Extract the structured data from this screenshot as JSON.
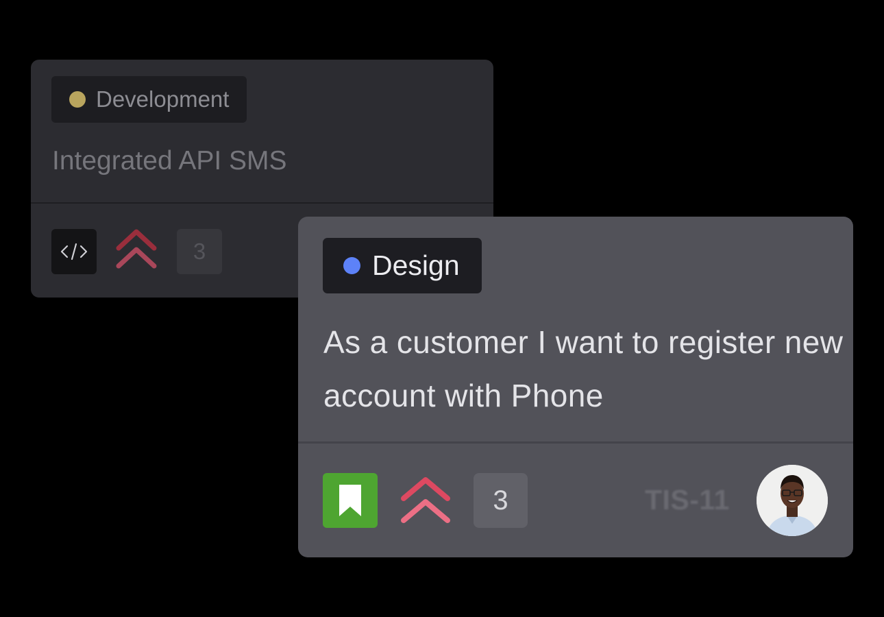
{
  "back_card": {
    "tag": {
      "label": "Development",
      "dot_color": "#b9a55e"
    },
    "title": "Integrated API SMS",
    "type_icon": "code-icon",
    "priority_icon": "double-chevron-up-icon",
    "estimate": "3"
  },
  "front_card": {
    "tag": {
      "label": "Design",
      "dot_color": "#5d82f8"
    },
    "title": "As a customer I want to register new account with Phone",
    "type_icon": "bookmark-icon",
    "type_color": "#4ea531",
    "priority_icon": "double-chevron-up-icon",
    "priority_color": "#e45a6e",
    "estimate": "3",
    "issue_key": "TIS-11",
    "assignee_avatar": "avatar-photo"
  }
}
